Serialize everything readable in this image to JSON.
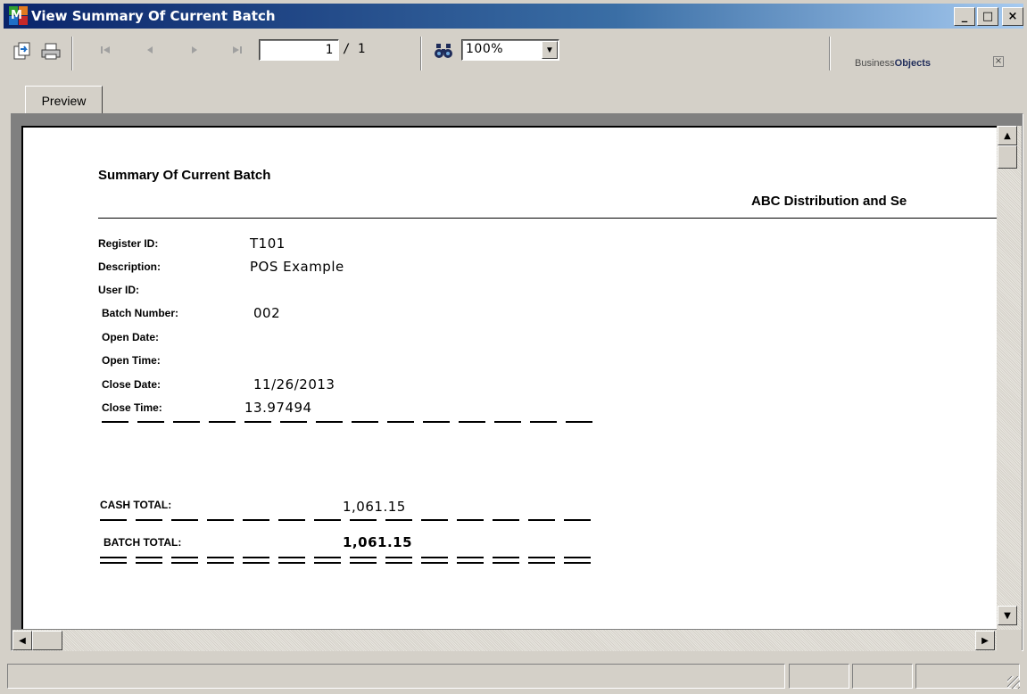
{
  "window": {
    "title": "View Summary Of Current Batch",
    "minimize_label": "_",
    "maximize_label": "□",
    "close_label": "×"
  },
  "toolbar": {
    "page_current": "1",
    "page_total": "/ 1",
    "zoom": "100%",
    "zoom_arrow": "▼",
    "logo_prefix": "Business",
    "logo_bold": "Objects",
    "logo_close": "×"
  },
  "tabs": [
    {
      "label": "Preview"
    }
  ],
  "report": {
    "title": "Summary Of Current Batch",
    "company": "ABC Distribution and Se",
    "fields": [
      {
        "label": "Register ID:",
        "value": "T101"
      },
      {
        "label": "Description:",
        "value": "POS Example"
      },
      {
        "label": "User ID:",
        "value": ""
      },
      {
        "label": "Batch Number:",
        "value": "002"
      },
      {
        "label": "Open Date:",
        "value": ""
      },
      {
        "label": "Open Time:",
        "value": ""
      },
      {
        "label": "Close Date:",
        "value": "11/26/2013"
      },
      {
        "label": "Close Time:",
        "value": "13.97494"
      }
    ],
    "cash_total_label": "CASH  TOTAL:",
    "cash_total_value": "1,061.15",
    "batch_total_label": "BATCH TOTAL:",
    "batch_total_value": "1,061.15"
  },
  "scroll": {
    "up": "▲",
    "down": "▼",
    "left": "◀",
    "right": "▶"
  }
}
